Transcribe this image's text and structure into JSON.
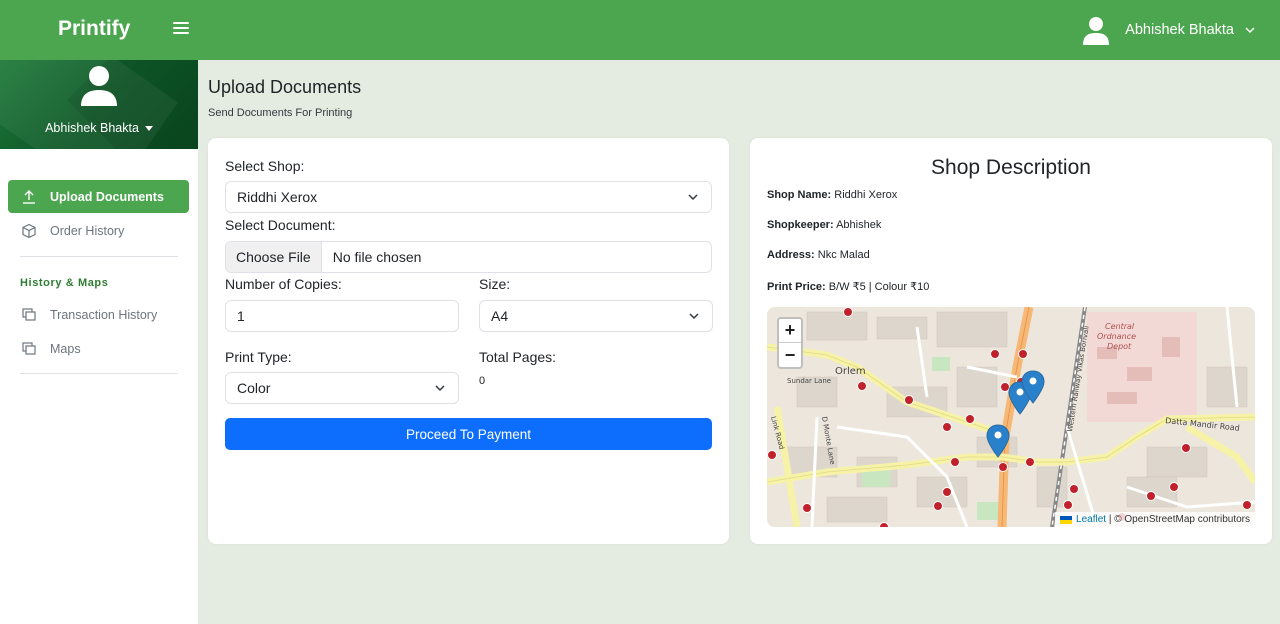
{
  "app": {
    "brand": "Printify",
    "user_name": "Abhishek Bhakta"
  },
  "sidebar": {
    "profile_name": "Abhishek Bhakta",
    "items": [
      {
        "label": "Upload Documents",
        "icon": "upload-icon",
        "active": true
      },
      {
        "label": "Order History",
        "icon": "box-icon",
        "active": false
      }
    ],
    "section_label": "History & Maps",
    "section_items": [
      {
        "label": "Transaction History",
        "icon": "copy-icon"
      },
      {
        "label": "Maps",
        "icon": "copy-icon"
      }
    ]
  },
  "page": {
    "title": "Upload Documents",
    "subtitle": "Send Documents For Printing"
  },
  "form": {
    "shop_label": "Select Shop:",
    "shop_value": "Riddhi Xerox",
    "document_label": "Select Document:",
    "file_button": "Choose File",
    "file_status": "No file chosen",
    "copies_label": "Number of Copies:",
    "copies_value": "1",
    "size_label": "Size:",
    "size_value": "A4",
    "print_type_label": "Print Type:",
    "print_type_value": "Color",
    "total_pages_label": "Total Pages:",
    "total_pages_value": "0",
    "submit_label": "Proceed To Payment"
  },
  "shop_description": {
    "title": "Shop Description",
    "shop_name_label": "Shop Name:",
    "shop_name": "Riddhi Xerox",
    "shopkeeper_label": "Shopkeeper:",
    "shopkeeper": "Abhishek",
    "address_label": "Address:",
    "address": "Nkc Malad",
    "print_price_label": "Print Price:",
    "print_price": "B/W ₹5 | Colour ₹10"
  },
  "map": {
    "zoom_in": "+",
    "zoom_out": "−",
    "labels": {
      "orlem": "Orlem",
      "sundar_lane": "Sundar Lane",
      "central_1": "Central",
      "central_2": "Ordnance",
      "central_3": "Depot",
      "datta_mandir": "Datta Mandir Road",
      "d_monte": "D Monte Lane",
      "link_road": "Link Road",
      "western_railway": "Western Railway Vikas Borivali"
    },
    "attribution_link": "Leaflet",
    "attribution_text": "| © OpenStreetMap contributors"
  },
  "colors": {
    "topbar": "#4ca64f",
    "active_nav": "#4ca64f",
    "primary_button": "#0d6efd",
    "background": "#e4ebe0"
  }
}
